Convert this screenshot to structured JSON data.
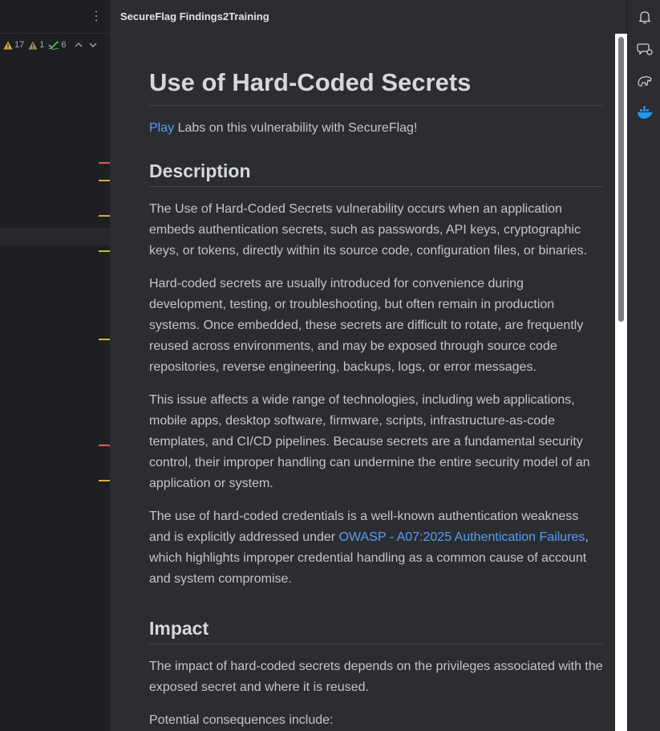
{
  "editor": {
    "menu_glyph": "⋮",
    "inspections": {
      "warnings_count": "17",
      "weak_warnings_count": "1",
      "typos_count": "6"
    }
  },
  "tool_window": {
    "title": "SecureFlag Findings2Training"
  },
  "article": {
    "title": "Use of Hard-Coded Secrets",
    "intro_link": "Play",
    "intro_text": " Labs on this vulnerability with SecureFlag!",
    "description_heading": "Description",
    "description_p1": "The Use of Hard-Coded Secrets vulnerability occurs when an application embeds authentication secrets, such as passwords, API keys, cryptographic keys, or tokens, directly within its source code, configuration files, or binaries.",
    "description_p2": "Hard-coded secrets are usually introduced for convenience during development, testing, or troubleshooting, but often remain in production systems. Once embedded, these secrets are difficult to rotate, are frequently reused across environments, and may be exposed through source code repositories, reverse engineering, backups, logs, or error messages.",
    "description_p3": "This issue affects a wide range of technologies, including web applications, mobile apps, desktop software, firmware, scripts, infrastructure-as-code templates, and CI/CD pipelines. Because secrets are a fundamental security control, their improper handling can undermine the entire security model of an application or system.",
    "description_p4_before": "The use of hard-coded credentials is a well-known authentication weakness and is explicitly addressed under ",
    "description_p4_link": "OWASP - A07:2025 Authentication Failures",
    "description_p4_after": ", which highlights improper credential handling as a common cause of account and system compromise.",
    "impact_heading": "Impact",
    "impact_p1": "The impact of hard-coded secrets depends on the privileges associated with the exposed secret and where it is reused.",
    "impact_p2": "Potential consequences include:"
  },
  "colors": {
    "link": "#589df6",
    "error_marker": "#db5c5c",
    "warning_marker": "#d6ad3e",
    "typo_check": "#5fb865"
  },
  "icons": [
    "more-vertical-icon",
    "warning-icon",
    "weak-warning-icon",
    "typo-check-icon",
    "chevron-up-icon",
    "chevron-down-icon",
    "notifications-bell-icon",
    "ai-chat-icon",
    "database-elephant-icon",
    "docker-whale-icon"
  ]
}
